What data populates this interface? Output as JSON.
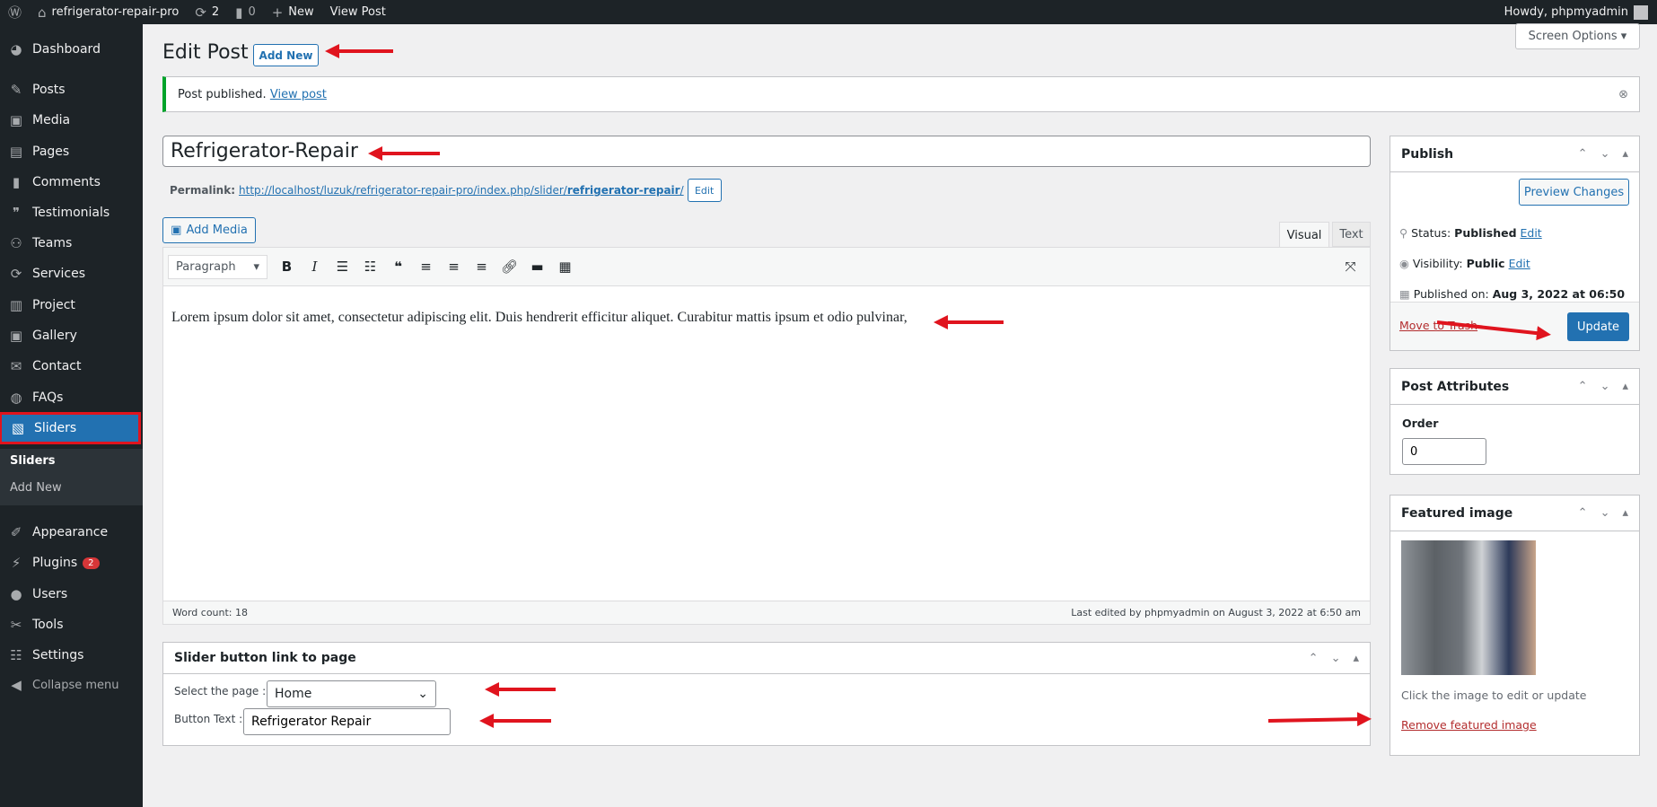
{
  "adminbar": {
    "site": "refrigerator-repair-pro",
    "updates": "2",
    "comments": "0",
    "new": "New",
    "view_post": "View Post",
    "howdy": "Howdy, phpmyadmin"
  },
  "sidebar": {
    "items": [
      {
        "label": "Dashboard",
        "icon": "dashboard-icon"
      },
      {
        "label": "Posts",
        "icon": "pin-icon"
      },
      {
        "label": "Media",
        "icon": "media-icon"
      },
      {
        "label": "Pages",
        "icon": "pages-icon"
      },
      {
        "label": "Comments",
        "icon": "comment-icon"
      },
      {
        "label": "Testimonials",
        "icon": "testimonial-icon"
      },
      {
        "label": "Teams",
        "icon": "groups-icon"
      },
      {
        "label": "Services",
        "icon": "update-icon"
      },
      {
        "label": "Project",
        "icon": "layout-icon"
      },
      {
        "label": "Gallery",
        "icon": "media-icon"
      },
      {
        "label": "Contact",
        "icon": "email-icon"
      },
      {
        "label": "FAQs",
        "icon": "chat-icon"
      },
      {
        "label": "Sliders",
        "icon": "slides-icon"
      },
      {
        "label": "Appearance",
        "icon": "brush-icon"
      },
      {
        "label": "Plugins",
        "icon": "plugin-icon",
        "badge": "2"
      },
      {
        "label": "Users",
        "icon": "user-icon"
      },
      {
        "label": "Tools",
        "icon": "wrench-icon"
      },
      {
        "label": "Settings",
        "icon": "settings-icon"
      },
      {
        "label": "Collapse menu",
        "icon": "collapse-icon"
      }
    ],
    "submenu": [
      "Sliders",
      "Add New"
    ]
  },
  "screen_options": "Screen Options",
  "page": {
    "title": "Edit Post",
    "add_new": "Add New"
  },
  "notice": {
    "text": "Post published.",
    "link": "View post"
  },
  "post": {
    "title": "Refrigerator-Repair",
    "permalink_label": "Permalink:",
    "permalink_base": "http://localhost/luzuk/refrigerator-repair-pro/index.php/slider/",
    "permalink_slug": "refrigerator-repair",
    "permalink_end": "/",
    "edit": "Edit"
  },
  "editor": {
    "add_media": "Add Media",
    "tab_visual": "Visual",
    "tab_text": "Text",
    "format": "Paragraph",
    "content": "Lorem ipsum dolor sit amet, consectetur adipiscing elit. Duis hendrerit efficitur aliquet. Curabitur mattis ipsum et odio pulvinar,",
    "word_count": "Word count: 18",
    "last_edited": "Last edited by phpmyadmin on August 3, 2022 at 6:50 am"
  },
  "slider_box": {
    "title": "Slider button link to page",
    "select_label": "Select the page :",
    "select_value": "Home",
    "button_label": "Button Text :",
    "button_value": "Refrigerator Repair"
  },
  "publish": {
    "title": "Publish",
    "preview": "Preview Changes",
    "status_label": "Status:",
    "status": "Published",
    "visibility_label": "Visibility:",
    "visibility": "Public",
    "published_label": "Published on:",
    "published": "Aug 3, 2022 at 06:50",
    "edit": "Edit",
    "trash": "Move to Trash",
    "update": "Update"
  },
  "attributes": {
    "title": "Post Attributes",
    "order_label": "Order",
    "order": "0"
  },
  "featured": {
    "title": "Featured image",
    "hint": "Click the image to edit or update",
    "remove": "Remove featured image"
  },
  "colors": {
    "accent": "#2271b1",
    "sidebar": "#1d2327",
    "annotation": "#e0141e",
    "notice": "#00a32a"
  }
}
